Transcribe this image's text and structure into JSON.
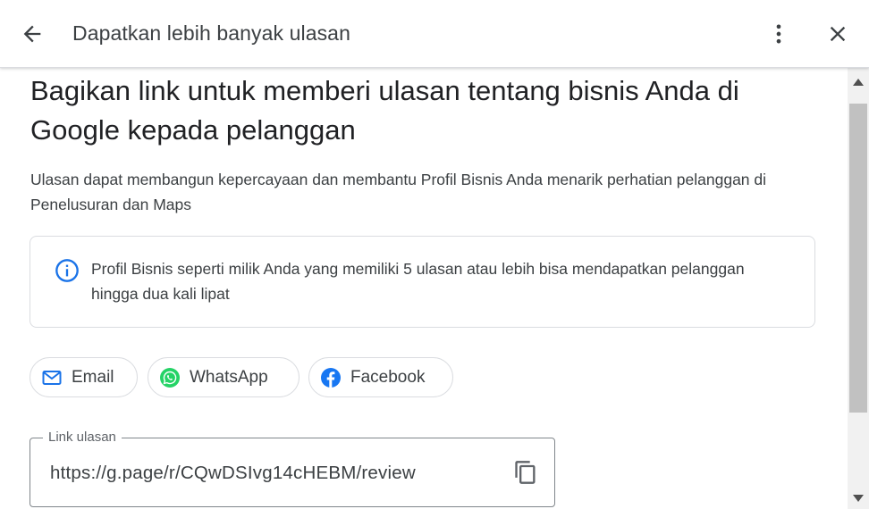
{
  "header": {
    "title": "Dapatkan lebih banyak ulasan"
  },
  "main": {
    "headline": "Bagikan link untuk memberi ulasan tentang bisnis Anda di Google kepada pelanggan",
    "subtitle": "Ulasan dapat membangun kepercayaan dan membantu Profil Bisnis Anda menarik perhatian pelanggan di Penelusuran dan Maps",
    "info": {
      "icon": "info-icon",
      "text": "Profil Bisnis seperti milik Anda yang memiliki 5 ulasan atau lebih bisa mendapatkan pelanggan hingga dua kali lipat"
    },
    "share_chips": [
      {
        "label": "Email",
        "icon": "email-icon"
      },
      {
        "label": "WhatsApp",
        "icon": "whatsapp-icon"
      },
      {
        "label": "Facebook",
        "icon": "facebook-icon"
      }
    ],
    "link_field": {
      "label": "Link ulasan",
      "value": "https://g.page/r/CQwDSIvg14cHEBM/review"
    }
  },
  "colors": {
    "accent": "#1a73e8",
    "whatsapp": "#25d366",
    "facebook": "#1877f2",
    "text": "#202124",
    "secondary_text": "#3c4043",
    "border": "#dadce0"
  }
}
